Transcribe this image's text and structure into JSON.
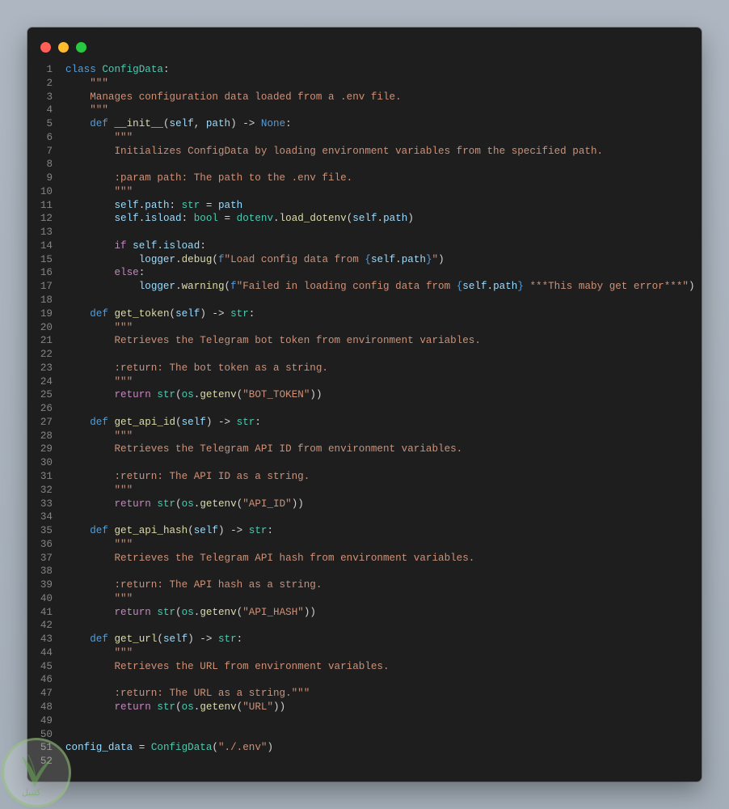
{
  "window": {
    "controls": [
      "close",
      "minimize",
      "maximize"
    ]
  },
  "colors": {
    "keyword": "#569cd6",
    "control": "#c586c0",
    "class": "#4ec9b0",
    "function": "#dcdcaa",
    "variable": "#9cdcfe",
    "string": "#ce9178",
    "plain": "#d4d4d4",
    "line_number": "#858585",
    "background": "#1e1e1e"
  },
  "code_lines": [
    {
      "n": "1",
      "tokens": [
        [
          "class",
          "kw"
        ],
        [
          " ",
          "op"
        ],
        [
          "ConfigData",
          "cls"
        ],
        [
          ":",
          "op"
        ]
      ]
    },
    {
      "n": "2",
      "tokens": [
        [
          "    \"\"\"",
          "str"
        ]
      ]
    },
    {
      "n": "3",
      "tokens": [
        [
          "    Manages configuration data loaded from a .env file.",
          "str"
        ]
      ]
    },
    {
      "n": "4",
      "tokens": [
        [
          "    \"\"\"",
          "str"
        ]
      ]
    },
    {
      "n": "5",
      "tokens": [
        [
          "    ",
          "op"
        ],
        [
          "def",
          "kw"
        ],
        [
          " ",
          "op"
        ],
        [
          "__init__",
          "fn"
        ],
        [
          "(",
          "op"
        ],
        [
          "self",
          "var"
        ],
        [
          ", ",
          "op"
        ],
        [
          "path",
          "var"
        ],
        [
          ") -> ",
          "op"
        ],
        [
          "None",
          "kw"
        ],
        [
          ":",
          "op"
        ]
      ]
    },
    {
      "n": "6",
      "tokens": [
        [
          "        \"\"\"",
          "str"
        ]
      ]
    },
    {
      "n": "7",
      "tokens": [
        [
          "        Initializes ConfigData by loading environment variables from the specified path.",
          "str"
        ]
      ]
    },
    {
      "n": "8",
      "tokens": []
    },
    {
      "n": "9",
      "tokens": [
        [
          "        :param path: The path to the .env file.",
          "str"
        ]
      ]
    },
    {
      "n": "10",
      "tokens": [
        [
          "        \"\"\"",
          "str"
        ]
      ]
    },
    {
      "n": "11",
      "tokens": [
        [
          "        ",
          "op"
        ],
        [
          "self",
          "var"
        ],
        [
          ".",
          "op"
        ],
        [
          "path",
          "var"
        ],
        [
          ": ",
          "op"
        ],
        [
          "str",
          "cls"
        ],
        [
          " = ",
          "op"
        ],
        [
          "path",
          "var"
        ]
      ]
    },
    {
      "n": "12",
      "tokens": [
        [
          "        ",
          "op"
        ],
        [
          "self",
          "var"
        ],
        [
          ".",
          "op"
        ],
        [
          "isload",
          "var"
        ],
        [
          ": ",
          "op"
        ],
        [
          "bool",
          "cls"
        ],
        [
          " = ",
          "op"
        ],
        [
          "dotenv",
          "cls"
        ],
        [
          ".",
          "op"
        ],
        [
          "load_dotenv",
          "fn"
        ],
        [
          "(",
          "op"
        ],
        [
          "self",
          "var"
        ],
        [
          ".",
          "op"
        ],
        [
          "path",
          "var"
        ],
        [
          ")",
          "op"
        ]
      ]
    },
    {
      "n": "13",
      "tokens": []
    },
    {
      "n": "14",
      "tokens": [
        [
          "        ",
          "op"
        ],
        [
          "if",
          "ctrl"
        ],
        [
          " ",
          "op"
        ],
        [
          "self",
          "var"
        ],
        [
          ".",
          "op"
        ],
        [
          "isload",
          "var"
        ],
        [
          ":",
          "op"
        ]
      ]
    },
    {
      "n": "15",
      "tokens": [
        [
          "            ",
          "op"
        ],
        [
          "logger",
          "var"
        ],
        [
          ".",
          "op"
        ],
        [
          "debug",
          "fn"
        ],
        [
          "(",
          "op"
        ],
        [
          "f",
          "kw"
        ],
        [
          "\"Load config data from ",
          "str"
        ],
        [
          "{",
          "kw"
        ],
        [
          "self",
          "var"
        ],
        [
          ".",
          "op"
        ],
        [
          "path",
          "var"
        ],
        [
          "}",
          "kw"
        ],
        [
          "\"",
          "str"
        ],
        [
          ")",
          "op"
        ]
      ]
    },
    {
      "n": "16",
      "tokens": [
        [
          "        ",
          "op"
        ],
        [
          "else",
          "ctrl"
        ],
        [
          ":",
          "op"
        ]
      ]
    },
    {
      "n": "17",
      "tokens": [
        [
          "            ",
          "op"
        ],
        [
          "logger",
          "var"
        ],
        [
          ".",
          "op"
        ],
        [
          "warning",
          "fn"
        ],
        [
          "(",
          "op"
        ],
        [
          "f",
          "kw"
        ],
        [
          "\"Failed in loading config data from ",
          "str"
        ],
        [
          "{",
          "kw"
        ],
        [
          "self",
          "var"
        ],
        [
          ".",
          "op"
        ],
        [
          "path",
          "var"
        ],
        [
          "}",
          "kw"
        ],
        [
          " ***This maby get error***\"",
          "str"
        ],
        [
          ")",
          "op"
        ]
      ]
    },
    {
      "n": "18",
      "tokens": []
    },
    {
      "n": "19",
      "tokens": [
        [
          "    ",
          "op"
        ],
        [
          "def",
          "kw"
        ],
        [
          " ",
          "op"
        ],
        [
          "get_token",
          "fn"
        ],
        [
          "(",
          "op"
        ],
        [
          "self",
          "var"
        ],
        [
          ") -> ",
          "op"
        ],
        [
          "str",
          "cls"
        ],
        [
          ":",
          "op"
        ]
      ]
    },
    {
      "n": "20",
      "tokens": [
        [
          "        \"\"\"",
          "str"
        ]
      ]
    },
    {
      "n": "21",
      "tokens": [
        [
          "        Retrieves the Telegram bot token from environment variables.",
          "str"
        ]
      ]
    },
    {
      "n": "22",
      "tokens": []
    },
    {
      "n": "23",
      "tokens": [
        [
          "        :return: The bot token as a string.",
          "str"
        ]
      ]
    },
    {
      "n": "24",
      "tokens": [
        [
          "        \"\"\"",
          "str"
        ]
      ]
    },
    {
      "n": "25",
      "tokens": [
        [
          "        ",
          "op"
        ],
        [
          "return",
          "ctrl"
        ],
        [
          " ",
          "op"
        ],
        [
          "str",
          "cls"
        ],
        [
          "(",
          "op"
        ],
        [
          "os",
          "cls"
        ],
        [
          ".",
          "op"
        ],
        [
          "getenv",
          "fn"
        ],
        [
          "(",
          "op"
        ],
        [
          "\"BOT_TOKEN\"",
          "str"
        ],
        [
          "))",
          "op"
        ]
      ]
    },
    {
      "n": "26",
      "tokens": []
    },
    {
      "n": "27",
      "tokens": [
        [
          "    ",
          "op"
        ],
        [
          "def",
          "kw"
        ],
        [
          " ",
          "op"
        ],
        [
          "get_api_id",
          "fn"
        ],
        [
          "(",
          "op"
        ],
        [
          "self",
          "var"
        ],
        [
          ") -> ",
          "op"
        ],
        [
          "str",
          "cls"
        ],
        [
          ":",
          "op"
        ]
      ]
    },
    {
      "n": "28",
      "tokens": [
        [
          "        \"\"\"",
          "str"
        ]
      ]
    },
    {
      "n": "29",
      "tokens": [
        [
          "        Retrieves the Telegram API ID from environment variables.",
          "str"
        ]
      ]
    },
    {
      "n": "30",
      "tokens": []
    },
    {
      "n": "31",
      "tokens": [
        [
          "        :return: The API ID as a string.",
          "str"
        ]
      ]
    },
    {
      "n": "32",
      "tokens": [
        [
          "        \"\"\"",
          "str"
        ]
      ]
    },
    {
      "n": "33",
      "tokens": [
        [
          "        ",
          "op"
        ],
        [
          "return",
          "ctrl"
        ],
        [
          " ",
          "op"
        ],
        [
          "str",
          "cls"
        ],
        [
          "(",
          "op"
        ],
        [
          "os",
          "cls"
        ],
        [
          ".",
          "op"
        ],
        [
          "getenv",
          "fn"
        ],
        [
          "(",
          "op"
        ],
        [
          "\"API_ID\"",
          "str"
        ],
        [
          "))",
          "op"
        ]
      ]
    },
    {
      "n": "34",
      "tokens": []
    },
    {
      "n": "35",
      "tokens": [
        [
          "    ",
          "op"
        ],
        [
          "def",
          "kw"
        ],
        [
          " ",
          "op"
        ],
        [
          "get_api_hash",
          "fn"
        ],
        [
          "(",
          "op"
        ],
        [
          "self",
          "var"
        ],
        [
          ") -> ",
          "op"
        ],
        [
          "str",
          "cls"
        ],
        [
          ":",
          "op"
        ]
      ]
    },
    {
      "n": "36",
      "tokens": [
        [
          "        \"\"\"",
          "str"
        ]
      ]
    },
    {
      "n": "37",
      "tokens": [
        [
          "        Retrieves the Telegram API hash from environment variables.",
          "str"
        ]
      ]
    },
    {
      "n": "38",
      "tokens": []
    },
    {
      "n": "39",
      "tokens": [
        [
          "        :return: The API hash as a string.",
          "str"
        ]
      ]
    },
    {
      "n": "40",
      "tokens": [
        [
          "        \"\"\"",
          "str"
        ]
      ]
    },
    {
      "n": "41",
      "tokens": [
        [
          "        ",
          "op"
        ],
        [
          "return",
          "ctrl"
        ],
        [
          " ",
          "op"
        ],
        [
          "str",
          "cls"
        ],
        [
          "(",
          "op"
        ],
        [
          "os",
          "cls"
        ],
        [
          ".",
          "op"
        ],
        [
          "getenv",
          "fn"
        ],
        [
          "(",
          "op"
        ],
        [
          "\"API_HASH\"",
          "str"
        ],
        [
          "))",
          "op"
        ]
      ]
    },
    {
      "n": "42",
      "tokens": []
    },
    {
      "n": "43",
      "tokens": [
        [
          "    ",
          "op"
        ],
        [
          "def",
          "kw"
        ],
        [
          " ",
          "op"
        ],
        [
          "get_url",
          "fn"
        ],
        [
          "(",
          "op"
        ],
        [
          "self",
          "var"
        ],
        [
          ") -> ",
          "op"
        ],
        [
          "str",
          "cls"
        ],
        [
          ":",
          "op"
        ]
      ]
    },
    {
      "n": "44",
      "tokens": [
        [
          "        \"\"\"",
          "str"
        ]
      ]
    },
    {
      "n": "45",
      "tokens": [
        [
          "        Retrieves the URL from environment variables.",
          "str"
        ]
      ]
    },
    {
      "n": "46",
      "tokens": []
    },
    {
      "n": "47",
      "tokens": [
        [
          "        :return: The URL as a string.\"\"\"",
          "str"
        ]
      ]
    },
    {
      "n": "48",
      "tokens": [
        [
          "        ",
          "op"
        ],
        [
          "return",
          "ctrl"
        ],
        [
          " ",
          "op"
        ],
        [
          "str",
          "cls"
        ],
        [
          "(",
          "op"
        ],
        [
          "os",
          "cls"
        ],
        [
          ".",
          "op"
        ],
        [
          "getenv",
          "fn"
        ],
        [
          "(",
          "op"
        ],
        [
          "\"URL\"",
          "str"
        ],
        [
          "))",
          "op"
        ]
      ]
    },
    {
      "n": "49",
      "tokens": []
    },
    {
      "n": "50",
      "tokens": []
    },
    {
      "n": "51",
      "tokens": [
        [
          "config_data",
          "var"
        ],
        [
          " = ",
          "op"
        ],
        [
          "ConfigData",
          "cls"
        ],
        [
          "(",
          "op"
        ],
        [
          "\"./.env\"",
          "str"
        ],
        [
          ")",
          "op"
        ]
      ]
    },
    {
      "n": "52",
      "tokens": []
    }
  ],
  "watermark": {
    "text": "كتبيل"
  }
}
